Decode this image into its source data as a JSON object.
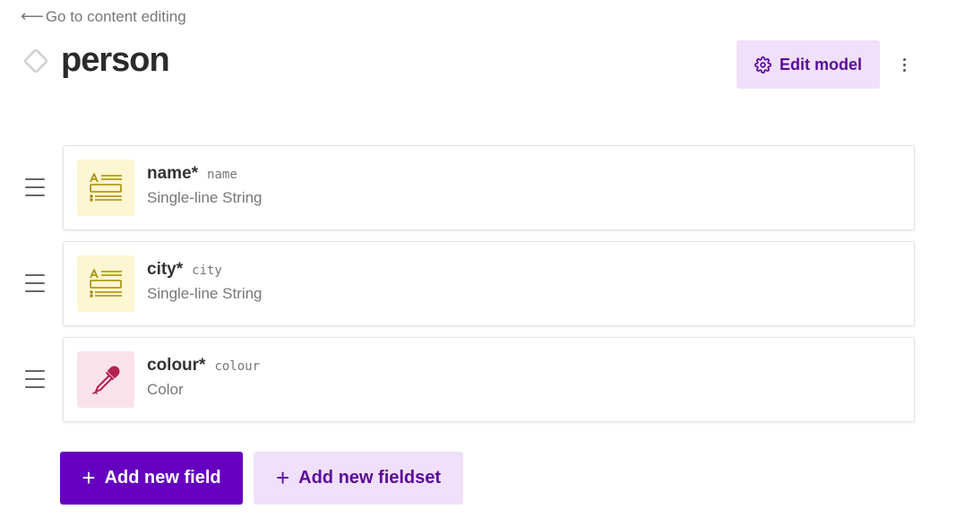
{
  "back_link": {
    "arrow": "⟵",
    "label": "Go to content editing"
  },
  "model": {
    "title": "person"
  },
  "toolbar": {
    "edit_model_label": "Edit model"
  },
  "fields": [
    {
      "label": "name*",
      "api_key": "name",
      "type": "Single-line String",
      "icon": "single-line-string-icon"
    },
    {
      "label": "city*",
      "api_key": "city",
      "type": "Single-line String",
      "icon": "single-line-string-icon"
    },
    {
      "label": "colour*",
      "api_key": "colour",
      "type": "Color",
      "icon": "color-dropper-icon"
    }
  ],
  "actions": {
    "add_field_label": "Add new field",
    "add_fieldset_label": "Add new fieldset",
    "plus": "+"
  },
  "colors": {
    "accent": "#6600c0",
    "accent_light": "#f0e0fb",
    "accent_text": "#5b0a99",
    "string_icon_bg": "#fdf6d2",
    "string_icon_fg": "#a68a00",
    "color_icon_bg": "#fbe2ea",
    "color_icon_fg": "#b0234f"
  }
}
